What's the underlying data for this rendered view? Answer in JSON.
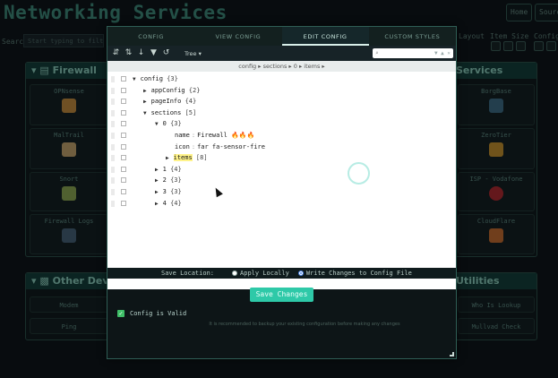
{
  "background": {
    "title": "Networking Services",
    "header_buttons": [
      "Home",
      "Source"
    ],
    "search_label": "Search",
    "search_placeholder": "Start typing to filter...",
    "controls": [
      "Layout",
      "Item Size",
      "Config"
    ],
    "sections": {
      "firewall": {
        "title": "Firewall",
        "items": [
          "OPNsense",
          "MalTrail",
          "Snort",
          "Firewall Logs"
        ]
      },
      "services_right": {
        "title": "Services",
        "items": [
          "BorgBase",
          "ZeroTier",
          "ISP - Vodafone",
          "CloudFlare"
        ]
      },
      "other_devices": {
        "title": "Other Devices",
        "items": [
          "Modem",
          "Ping"
        ]
      },
      "utilities": {
        "title": "Utilities",
        "items": [
          "Who Is Lookup",
          "Mullvad Check"
        ]
      }
    }
  },
  "modal": {
    "tabs": [
      {
        "label": "CONFIG",
        "active": false
      },
      {
        "label": "VIEW CONFIG",
        "active": false
      },
      {
        "label": "EDIT CONFIG",
        "active": true
      },
      {
        "label": "CUSTOM STYLES",
        "active": false
      }
    ],
    "toolbar": {
      "mode_label": "Tree ▾",
      "icons": [
        "expand-all-icon",
        "collapse-all-icon",
        "sort-icon",
        "filter-icon",
        "undo-icon"
      ]
    },
    "breadcrumb": "config ▸ sections ▸ 0 ▸ items ▸",
    "tree": {
      "root": {
        "key": "config",
        "count": "{3}"
      },
      "appConfig": {
        "key": "appConfig",
        "count": "{2}"
      },
      "pageInfo": {
        "key": "pageInfo",
        "count": "{4}"
      },
      "sections": {
        "key": "sections",
        "count": "[5]"
      },
      "s0": {
        "key": "0",
        "count": "{3}"
      },
      "name": {
        "key": "name",
        "value": "Firewall",
        "emoji": "🔥🔥🔥"
      },
      "icon": {
        "key": "icon",
        "value": "far fa-sensor-fire"
      },
      "items": {
        "key": "items",
        "count": "[8]"
      },
      "s1": {
        "key": "1",
        "count": "{4}"
      },
      "s2": {
        "key": "2",
        "count": "{3}"
      },
      "s3": {
        "key": "3",
        "count": "{3}"
      },
      "s4": {
        "key": "4",
        "count": "{4}"
      }
    },
    "save_location": {
      "label": "Save Location:",
      "options": [
        {
          "label": "Apply Locally",
          "selected": false
        },
        {
          "label": "Write Changes to Config File",
          "selected": true
        }
      ]
    },
    "save_button": "Save Changes",
    "valid_label": "Config is Valid",
    "note": "It is recommended to backup your existing configuration before making any changes"
  },
  "colors": {
    "accent": "#2ec9a8",
    "title": "#3e8a78",
    "valid": "#3fbf68",
    "highlight": "#fff38a"
  }
}
